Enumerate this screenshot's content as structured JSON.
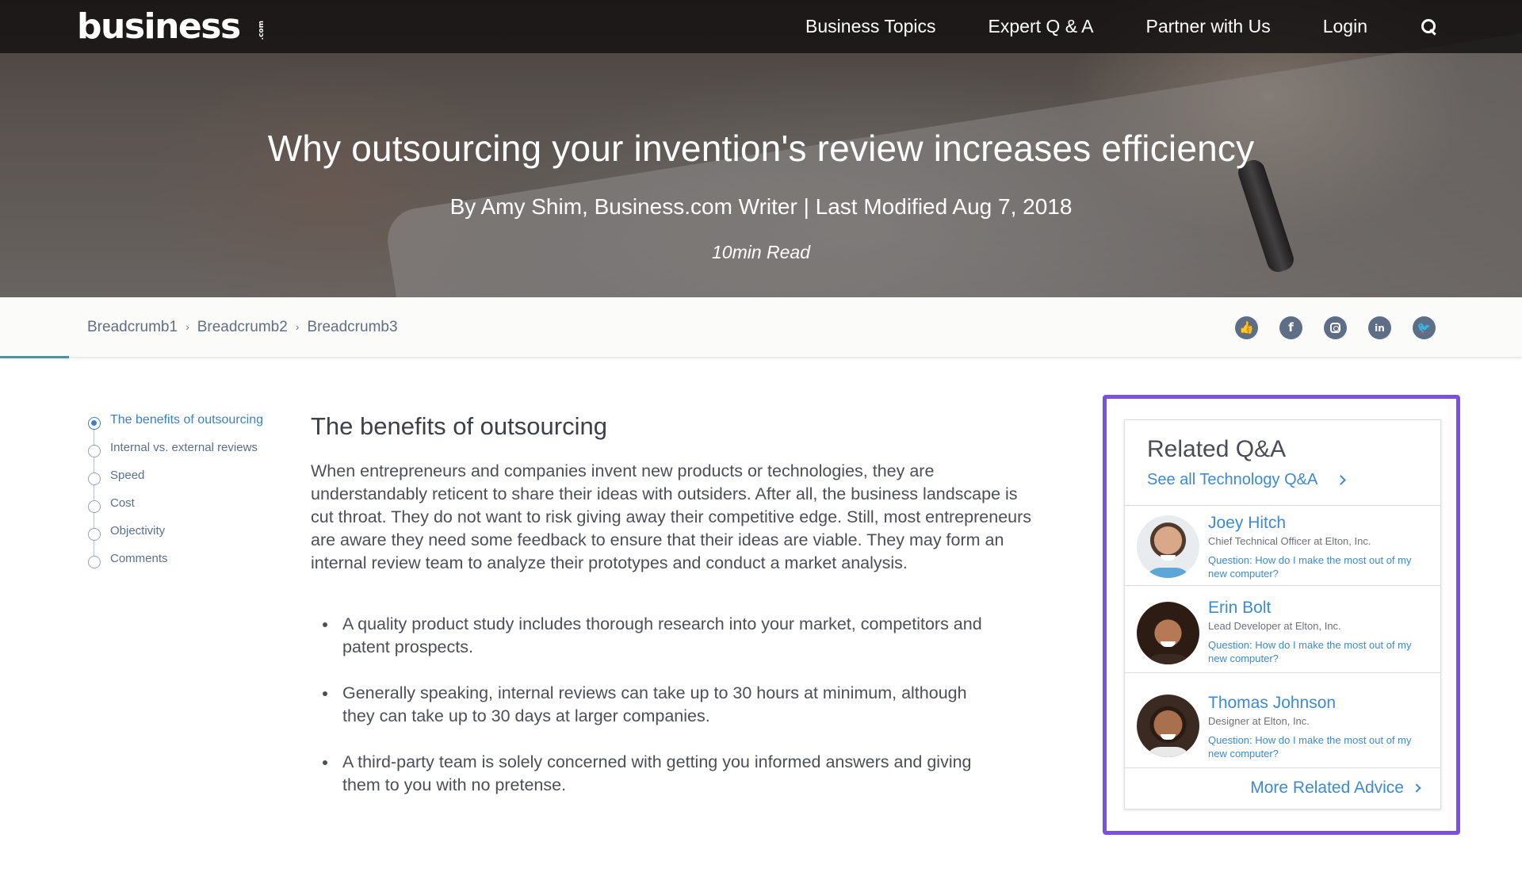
{
  "nav": {
    "logo": "business",
    "logo_suffix": ".com",
    "links": [
      "Business Topics",
      "Expert Q & A",
      "Partner with Us",
      "Login"
    ],
    "search_icon": "search-icon"
  },
  "hero": {
    "title": "Why outsourcing your invention's review increases efficiency",
    "byline": "By Amy Shim, Business.com Writer | Last Modified Aug 7, 2018",
    "read_time": "10min Read"
  },
  "breadcrumbs": [
    "Breadcrumb1",
    "Breadcrumb2",
    "Breadcrumb3"
  ],
  "socials": [
    "thumbs-up-icon",
    "facebook-icon",
    "instagram-icon",
    "linkedin-icon",
    "twitter-icon"
  ],
  "toc": [
    {
      "label": "The benefits of outsourcing",
      "active": true
    },
    {
      "label": "Internal vs. external reviews",
      "active": false
    },
    {
      "label": "Speed",
      "active": false
    },
    {
      "label": "Cost",
      "active": false
    },
    {
      "label": "Objectivity",
      "active": false
    },
    {
      "label": "Comments",
      "active": false
    }
  ],
  "article": {
    "heading": "The benefits of outsourcing",
    "paragraph": "When entrepreneurs and companies invent new products or technologies, they are understandably reticent to share their ideas with outsiders. After all, the business landscape is cut throat. They do not want to risk giving away their competitive edge. Still, most entrepreneurs are aware they need some feedback to ensure that their ideas are viable. They may form an internal review team to analyze their prototypes and conduct a market analysis.",
    "bullets": [
      "A quality product study includes thorough research into your market, competitors and patent prospects.",
      "Generally speaking, internal reviews can take up to 30 hours at minimum, although they can take up to 30 days at larger companies.",
      "A third-party team is solely concerned with getting you informed answers and giving them to you with no pretense."
    ]
  },
  "related_qa": {
    "title": "Related Q&A",
    "see_all": "See all Technology Q&A",
    "people": [
      {
        "name": "Joey Hitch",
        "role": "Chief Technical Officer at Elton, Inc.",
        "question": "Question: How do I make the most out of my new computer?"
      },
      {
        "name": "Erin Bolt",
        "role": "Lead Developer at Elton, Inc.",
        "question": "Question: How do I make the most out of my new computer?"
      },
      {
        "name": "Thomas Johnson",
        "role": "Designer at Elton, Inc.",
        "question": "Question: How do I make the most out of my new computer?"
      }
    ],
    "more": "More Related Advice"
  },
  "colors": {
    "accent": "#3d8ad3",
    "highlight": "#7b50e0",
    "social": "#5d6e86",
    "progress": "#4a94a8"
  }
}
